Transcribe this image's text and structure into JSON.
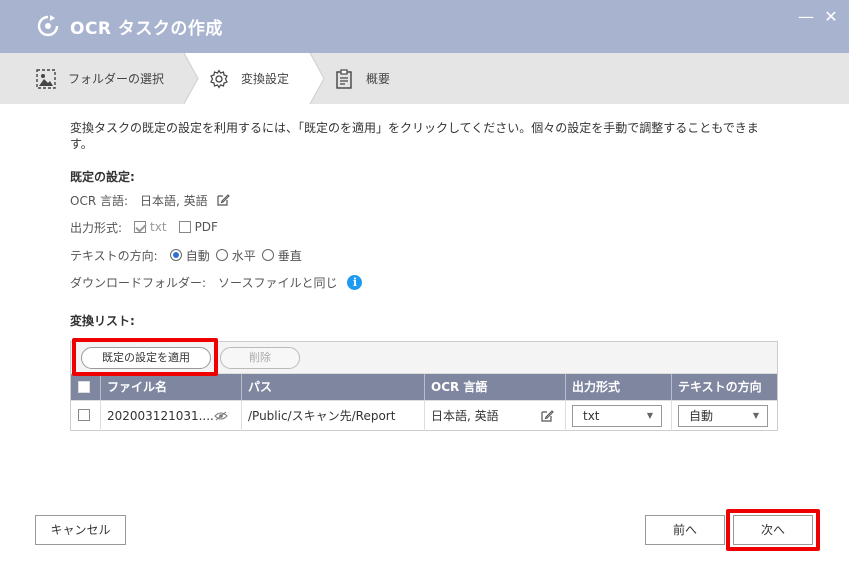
{
  "window": {
    "title": "OCR タスクの作成",
    "minimize_label": "—",
    "close_label": "✕"
  },
  "steps": [
    {
      "label": "フォルダーの選択",
      "icon": "image-folder-icon"
    },
    {
      "label": "変換設定",
      "icon": "gear-icon"
    },
    {
      "label": "概要",
      "icon": "clipboard-icon"
    }
  ],
  "description": "変換タスクの既定の設定を利用するには、「既定のを適用」をクリックしてください。個々の設定を手動で調整することもできます。",
  "defaults": {
    "title": "既定の設定:",
    "ocr_language_label": "OCR 言語:",
    "ocr_language_value": "日本語, 英語",
    "output_format_label": "出力形式:",
    "output_txt": "txt",
    "output_pdf": "PDF",
    "text_direction_label": "テキストの方向:",
    "direction_auto": "自動",
    "direction_horizontal": "水平",
    "direction_vertical": "垂直",
    "download_folder_label": "ダウンロードフォルダー:",
    "download_folder_value": "ソースファイルと同じ",
    "info_glyph": "i"
  },
  "list": {
    "title": "変換リスト:",
    "apply_button": "既定の設定を適用",
    "delete_button": "削除",
    "columns": [
      "ファイル名",
      "パス",
      "OCR 言語",
      "出力形式",
      "テキストの方向"
    ],
    "rows": [
      {
        "filename": "202003121031....",
        "path": "/Public/スキャン先/Report",
        "language": "日本語, 英語",
        "format": "txt",
        "direction": "自動"
      }
    ]
  },
  "footer": {
    "cancel": "キャンセル",
    "prev": "前へ",
    "next": "次へ"
  },
  "colors": {
    "titlebar": "#a8b3cf",
    "table_header": "#7f86a0",
    "highlight": "#ee0000",
    "info": "#1e9bf0"
  }
}
